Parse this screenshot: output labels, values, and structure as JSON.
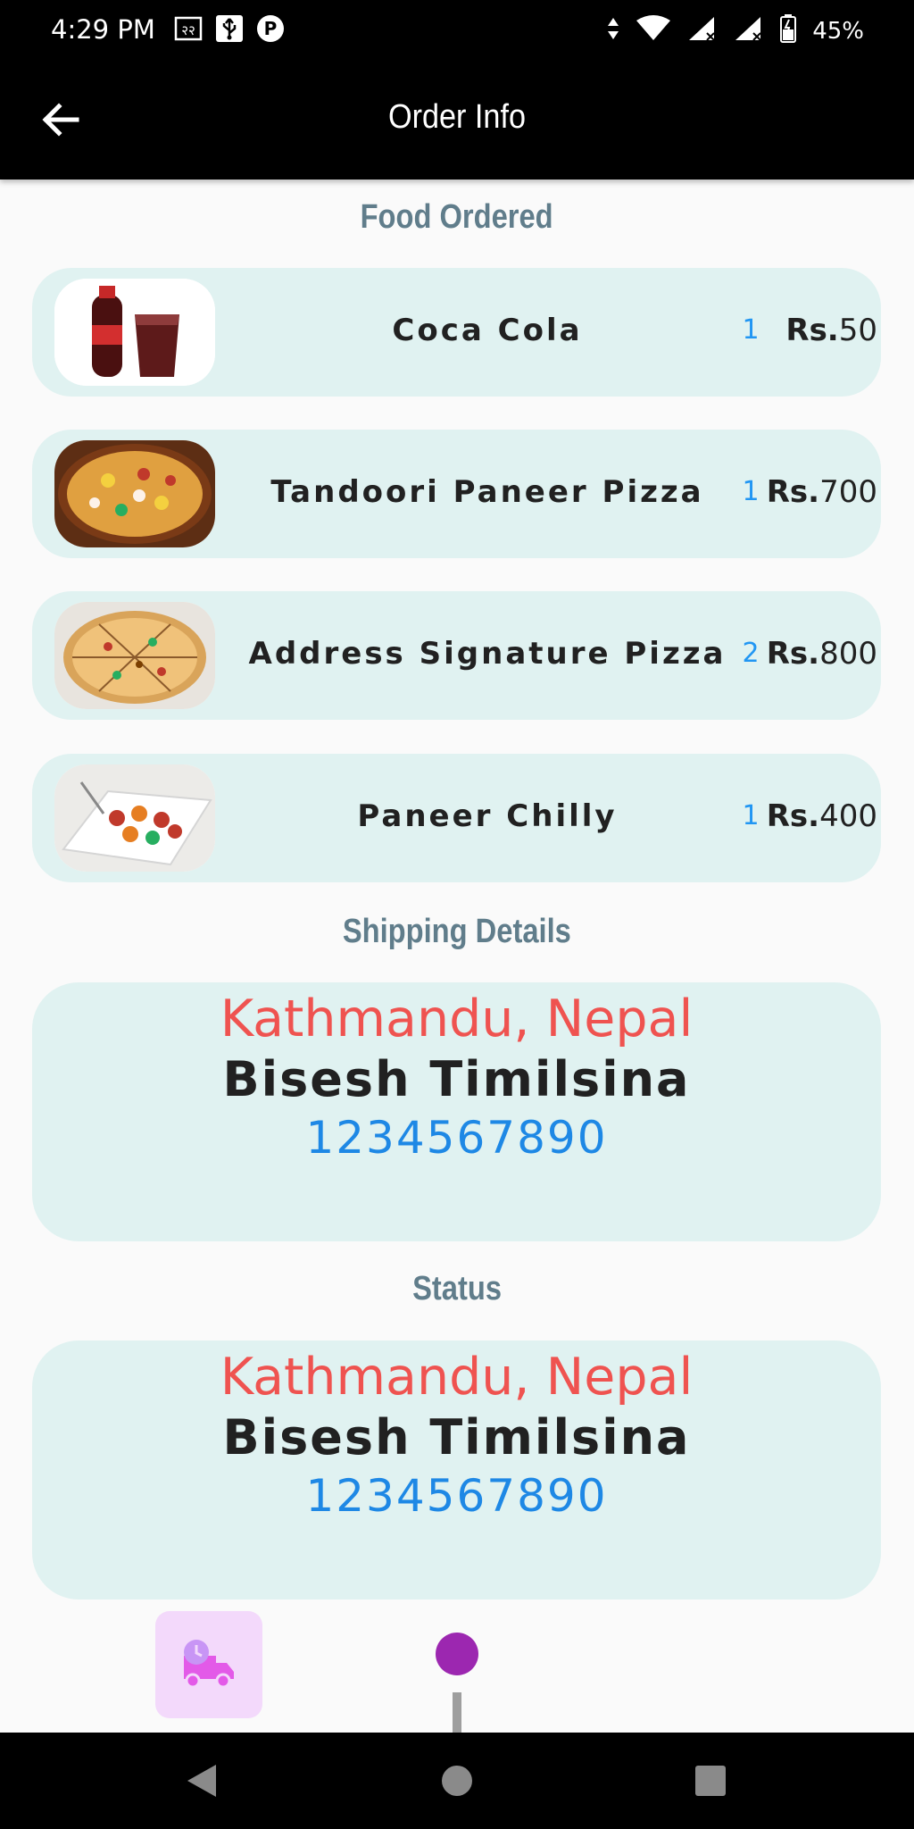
{
  "status_bar": {
    "time": "4:29 PM",
    "battery": "45%",
    "icons_left": [
      "data-saver-icon",
      "usb-icon",
      "parking-icon"
    ],
    "icons_right": [
      "data-arrows-icon",
      "wifi-icon",
      "signal-icon",
      "signal-no-data-icon",
      "battery-icon"
    ]
  },
  "app_bar": {
    "title": "Order Info",
    "back_icon": "arrow-left-icon"
  },
  "sections": {
    "food": "Food Ordered",
    "shipping": "Shipping Details",
    "status": "Status"
  },
  "food_items": [
    {
      "name": "Coca Cola",
      "qty": "1",
      "currency": "Rs.",
      "price": "50",
      "image": "coca-cola-image"
    },
    {
      "name": "Tandoori Paneer Pizza",
      "qty": "1",
      "currency": "Rs.",
      "price": "700",
      "image": "tandoori-pizza-image"
    },
    {
      "name": "Address Signature Pizza",
      "qty": "2",
      "currency": "Rs.",
      "price": "800",
      "image": "signature-pizza-image"
    },
    {
      "name": "Paneer Chilly",
      "qty": "1",
      "currency": "Rs.",
      "price": "400",
      "image": "paneer-chilly-image"
    }
  ],
  "shipping": {
    "city": "Kathmandu, Nepal",
    "name": "Bisesh Timilsina",
    "phone": "1234567890"
  },
  "status_info": {
    "city": "Kathmandu, Nepal",
    "name": "Bisesh Timilsina",
    "phone": "1234567890"
  },
  "timeline": {
    "icon": "delivery-truck-clock-icon"
  },
  "colors": {
    "section_title": "#607d8b",
    "card_bg": "#e0f2f1",
    "city": "#ef5350",
    "phone": "#1e88e5",
    "qty": "#2196f3",
    "timeline_dot": "#9c27b0",
    "timeline_box": "#f3d9fb"
  },
  "nav_bar": {
    "back": "nav-back-icon",
    "home": "nav-home-icon",
    "recents": "nav-recents-icon"
  }
}
